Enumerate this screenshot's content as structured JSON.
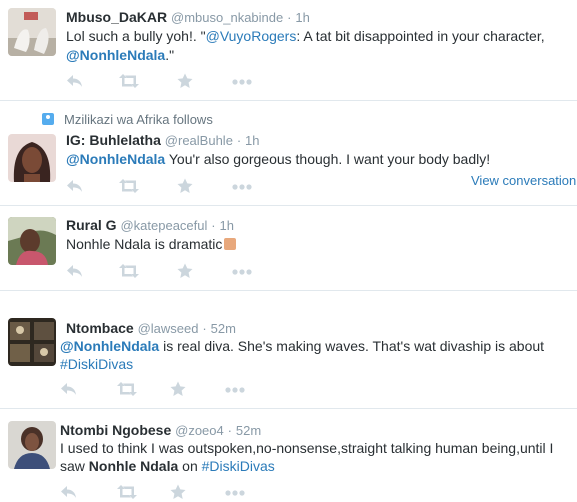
{
  "tweets": [
    {
      "name": "Mbuso_DaKAR",
      "handle": "@mbuso_nkabinde",
      "time": "1h",
      "text_a": "Lol such a bully yoh!. \"",
      "mention1": "@VuyoRogers",
      "text_b": ": A tat bit disappointed in your character,",
      "mention2": "@NonhleNdala",
      "text_c": ".\""
    },
    {
      "context": "Mzilikazi wa Afrika follows",
      "name": "IG: Buhlelatha",
      "handle": "@realBuhle",
      "time": "1h",
      "mention1": "@NonhleNdala",
      "text_a": " You'r also gorgeous though. I want your body badly!",
      "view_conversation": "View conversation"
    },
    {
      "name": "Rural G",
      "handle": "@katepeaceful",
      "time": "1h",
      "text_a": "Nonhle Ndala is dramatic"
    },
    {
      "name": "Ntombace",
      "handle": "@lawseed",
      "time": "52m",
      "mention1": "@NonhleNdala",
      "text_a": "  is real diva. She's making waves. That's wat divaship is about",
      "hashtag": "#DiskiDivas"
    },
    {
      "name": "Ntombi Ngobese",
      "handle": "@zoeo4",
      "time": "52m",
      "text_a": "I used to think I was outspoken,no-nonsense,straight talking human being,until I",
      "text_b": "saw ",
      "bold": "Nonhle Ndala",
      "text_c": " on ",
      "hashtag": "#DiskiDivas"
    }
  ],
  "separator": "·",
  "icons": [
    "reply-icon",
    "retweet-icon",
    "favorite-icon",
    "more-icon"
  ],
  "colors": {
    "link": "#2b7bb9",
    "muted": "#8899a6",
    "icon": "#ccd6dd",
    "divider": "#e1e8ed"
  }
}
